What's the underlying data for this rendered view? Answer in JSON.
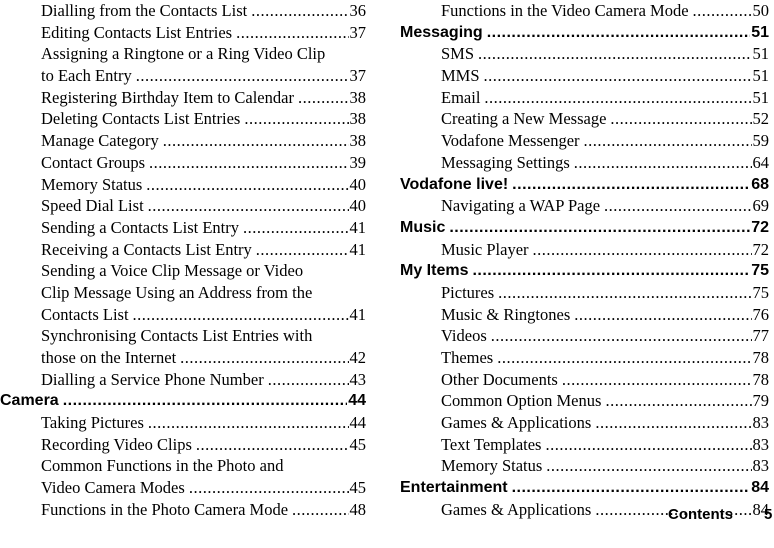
{
  "left_column": [
    {
      "type": "entry",
      "title": "Dialling from the Contacts List",
      "page": "36"
    },
    {
      "type": "entry",
      "title": "Editing Contacts List Entries",
      "page": "37"
    },
    {
      "type": "cont",
      "title": "Assigning a Ringtone or a Ring Video Clip"
    },
    {
      "type": "entry",
      "title": "to Each Entry",
      "page": "37"
    },
    {
      "type": "entry",
      "title": "Registering Birthday Item to Calendar",
      "page": "38"
    },
    {
      "type": "entry",
      "title": "Deleting Contacts List Entries",
      "page": "38"
    },
    {
      "type": "entry",
      "title": "Manage Category",
      "page": "38"
    },
    {
      "type": "entry",
      "title": "Contact Groups",
      "page": "39"
    },
    {
      "type": "entry",
      "title": "Memory Status",
      "page": "40"
    },
    {
      "type": "entry",
      "title": "Speed Dial List",
      "page": "40"
    },
    {
      "type": "entry",
      "title": "Sending a Contacts List Entry",
      "page": "41"
    },
    {
      "type": "entry",
      "title": "Receiving a Contacts List Entry",
      "page": "41"
    },
    {
      "type": "cont",
      "title": "Sending a Voice Clip Message or Video"
    },
    {
      "type": "cont",
      "title": "Clip Message Using an Address from the"
    },
    {
      "type": "entry",
      "title": "Contacts List",
      "page": "41"
    },
    {
      "type": "cont",
      "title": "Synchronising Contacts List Entries with"
    },
    {
      "type": "entry",
      "title": "those on the Internet",
      "page": "42"
    },
    {
      "type": "entry",
      "title": "Dialling a Service Phone Number",
      "page": "43"
    },
    {
      "type": "section",
      "title": "Camera",
      "page": "44"
    },
    {
      "type": "entry",
      "title": "Taking Pictures",
      "page": "44"
    },
    {
      "type": "entry",
      "title": "Recording Video Clips",
      "page": "45"
    },
    {
      "type": "cont",
      "title": "Common Functions in the Photo and"
    },
    {
      "type": "entry",
      "title": "Video Camera Modes",
      "page": "45"
    },
    {
      "type": "entry",
      "title": "Functions in the Photo Camera Mode",
      "page": "48"
    }
  ],
  "right_column": [
    {
      "type": "entry",
      "title": "Functions in the Video Camera Mode",
      "page": "50"
    },
    {
      "type": "section",
      "title": "Messaging",
      "page": "51"
    },
    {
      "type": "entry",
      "title": "SMS",
      "page": "51"
    },
    {
      "type": "entry",
      "title": "MMS",
      "page": "51"
    },
    {
      "type": "entry",
      "title": "Email",
      "page": "51"
    },
    {
      "type": "entry",
      "title": "Creating a New Message",
      "page": "52"
    },
    {
      "type": "entry",
      "title": "Vodafone Messenger",
      "page": "59"
    },
    {
      "type": "entry",
      "title": "Messaging Settings",
      "page": "64"
    },
    {
      "type": "section",
      "title": "Vodafone live!",
      "page": "68"
    },
    {
      "type": "entry",
      "title": "Navigating a WAP Page",
      "page": "69"
    },
    {
      "type": "section",
      "title": "Music",
      "page": "72"
    },
    {
      "type": "entry",
      "title": "Music Player",
      "page": "72"
    },
    {
      "type": "section",
      "title": "My Items",
      "page": "75"
    },
    {
      "type": "entry",
      "title": "Pictures",
      "page": "75"
    },
    {
      "type": "entry",
      "title": "Music & Ringtones",
      "page": "76"
    },
    {
      "type": "entry",
      "title": "Videos",
      "page": "77"
    },
    {
      "type": "entry",
      "title": "Themes",
      "page": "78"
    },
    {
      "type": "entry",
      "title": "Other Documents",
      "page": "78"
    },
    {
      "type": "entry",
      "title": "Common Option Menus",
      "page": "79"
    },
    {
      "type": "entry",
      "title": "Games & Applications",
      "page": "83"
    },
    {
      "type": "entry",
      "title": "Text Templates",
      "page": "83"
    },
    {
      "type": "entry",
      "title": "Memory Status",
      "page": "83"
    },
    {
      "type": "section",
      "title": "Entertainment",
      "page": "84"
    },
    {
      "type": "entry",
      "title": "Games & Applications",
      "page": "84"
    }
  ],
  "footer": {
    "label": "Contents",
    "page_number": "5"
  }
}
